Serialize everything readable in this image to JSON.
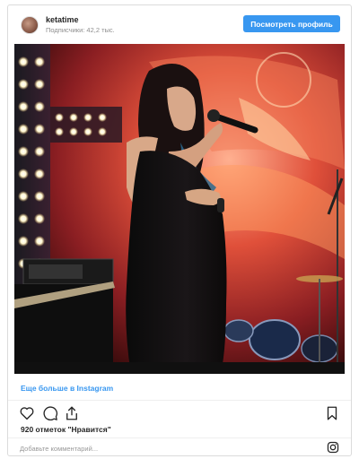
{
  "header": {
    "username": "ketatime",
    "followers": "Подписчики: 42,2 тыс.",
    "profile_button": "Посмотреть профиль"
  },
  "photo": {
    "icon": "concert-photo"
  },
  "more_link": "Еще больше в Instagram",
  "actions": {
    "like_icon": "heart-icon",
    "comment_icon": "comment-icon",
    "share_icon": "share-icon",
    "save_icon": "bookmark-icon"
  },
  "likes": "920 отметок \"Нравится\"",
  "comment": {
    "placeholder": "Добавьте комментарий..."
  },
  "colors": {
    "accent": "#3897f0",
    "border": "#dbdbdb",
    "text": "#262626",
    "muted": "#8e8e8e"
  }
}
